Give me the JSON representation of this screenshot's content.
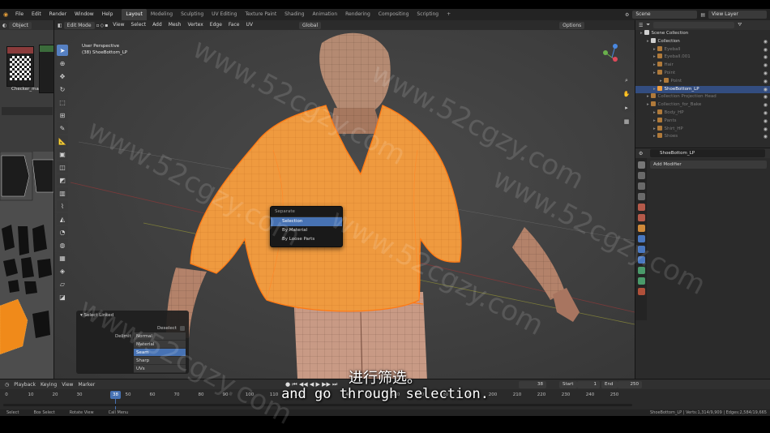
{
  "topbar": {
    "menus": [
      "File",
      "Edit",
      "Render",
      "Window",
      "Help"
    ],
    "workspaces": [
      "Layout",
      "Modeling",
      "Sculpting",
      "UV Editing",
      "Texture Paint",
      "Shading",
      "Animation",
      "Rendering",
      "Compositing",
      "Scripting"
    ],
    "active_workspace": "Layout",
    "scene": "Scene",
    "view_layer": "View Layer"
  },
  "left_panel": {
    "mode": "Object",
    "node_label": "Checker_ma"
  },
  "viewport": {
    "mode": "Edit Mode",
    "menus": [
      "View",
      "Select",
      "Add",
      "Mesh",
      "Vertex",
      "Edge",
      "Face",
      "UV"
    ],
    "orientation": "Global",
    "options": "Options",
    "info_line1": "User Perspective",
    "info_line2": "(38) ShoeBottom_LP"
  },
  "separate_menu": {
    "title": "Separate",
    "items": [
      "Selection",
      "By Material",
      "By Loose Parts"
    ],
    "active_index": 0
  },
  "select_linked": {
    "title": "Select Linked",
    "deselect_label": "Deselect",
    "delimit_label": "Delimit",
    "delimit_options": [
      "Normal",
      "Material",
      "Seam",
      "Sharp",
      "UVs"
    ],
    "active_index": 2
  },
  "outliner": {
    "search_placeholder": "",
    "rows": [
      {
        "label": "Scene Collection",
        "indent": 0,
        "state": "normal"
      },
      {
        "label": "Collection",
        "indent": 1,
        "state": "normal"
      },
      {
        "label": "Eyeball",
        "indent": 2,
        "state": "dim"
      },
      {
        "label": "Eyeball.001",
        "indent": 2,
        "state": "dim"
      },
      {
        "label": "Hair",
        "indent": 2,
        "state": "dim"
      },
      {
        "label": "Point",
        "indent": 2,
        "state": "dim"
      },
      {
        "label": "Point",
        "indent": 3,
        "state": "dim"
      },
      {
        "label": "ShoeBottom_LP",
        "indent": 2,
        "state": "selected"
      },
      {
        "label": "Collection Projection Head",
        "indent": 1,
        "state": "dim"
      },
      {
        "label": "Collection_for_Bake",
        "indent": 1,
        "state": "dim"
      },
      {
        "label": "Body_HP",
        "indent": 2,
        "state": "dim"
      },
      {
        "label": "Pants",
        "indent": 2,
        "state": "dim"
      },
      {
        "label": "Shirt_HP",
        "indent": 2,
        "state": "dim"
      },
      {
        "label": "Shoes",
        "indent": 2,
        "state": "dim"
      }
    ]
  },
  "properties": {
    "object_name": "ShoeBottom_LP",
    "add_modifier": "Add Modifier"
  },
  "timeline": {
    "menus": [
      "Playback",
      "Keying",
      "View",
      "Marker"
    ],
    "frame_numbers": [
      "0",
      "10",
      "20",
      "30",
      "50",
      "60",
      "70",
      "80",
      "90",
      "100",
      "110",
      "120",
      "130",
      "140",
      "150",
      "160",
      "170",
      "180",
      "190",
      "200",
      "210",
      "220",
      "230",
      "240",
      "250"
    ],
    "current_frame": "38",
    "current_frame_field": "38",
    "start_label": "Start",
    "start_value": "1",
    "end_label": "End",
    "end_value": "250"
  },
  "statusbar": {
    "items": [
      "Select",
      "Box Select",
      "Rotate View",
      "Call Menu"
    ],
    "stats": "ShoeBottom_LP | Verts:1,314/9,909 | Edges:2,584/19,665"
  },
  "subtitles": {
    "chinese": "进行筛选。",
    "english": "and go through selection."
  },
  "watermark_text": "www.52cgzy.com",
  "colors": {
    "accent_blue": "#4772b3",
    "selection_orange": "#ff8a1f",
    "shirt_orange": "#ef9a3f"
  }
}
